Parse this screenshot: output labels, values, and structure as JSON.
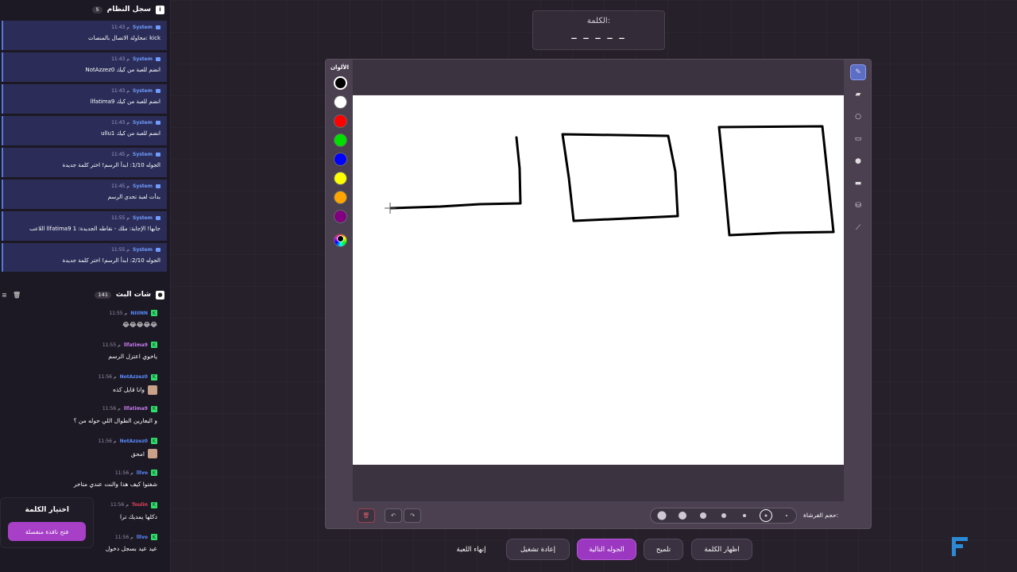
{
  "system_log": {
    "title": "سجل النظام",
    "count": "5",
    "items": [
      {
        "name": "System",
        "time": "11:43 م",
        "message": "محاولة الاتصال بالمنصات: kick"
      },
      {
        "name": "System",
        "time": "11:43 م",
        "message": "NotAzzez0 انضم للعبة من كيك"
      },
      {
        "name": "System",
        "time": "11:43 م",
        "message": "llfatima9 انضم للعبة من كيك"
      },
      {
        "name": "System",
        "time": "11:43 م",
        "message": "ullu1 انضم للعبة من كيك"
      },
      {
        "name": "System",
        "time": "11:45 م",
        "message": "الجوله 1/10: ابدأ الرسم! اختر كلمة جديدة"
      },
      {
        "name": "System",
        "time": "11:45 م",
        "message": "بدأت لعبة تحدي الرسم"
      },
      {
        "name": "System",
        "time": "11:55 م",
        "message": "اللاعب llfatima9 جابها! الإجابة: ملك - نقاطه الجديدة: 1"
      },
      {
        "name": "System",
        "time": "11:55 م",
        "message": "الجوله 2/10: ابدأ الرسم! اختر كلمة جديدة"
      }
    ]
  },
  "chat": {
    "title": "شات البث",
    "count": "141",
    "messages": [
      {
        "name": "NIIINN",
        "name_color": "#5a8cff",
        "time": "11:55 م",
        "message": "😂😂😂😂😂"
      },
      {
        "name": "llfatima9",
        "name_color": "#c87cf0",
        "time": "11:55 م",
        "message": "ياخوي اعتزل الرسم"
      },
      {
        "name": "NotAzzez0",
        "name_color": "#5a8cff",
        "time": "11:56 م",
        "message": "وانا قايل كذه"
      },
      {
        "name": "llfatima9",
        "name_color": "#c87cf0",
        "time": "11:56 م",
        "message": "و البعارين الطوال اللي حوله من ؟"
      },
      {
        "name": "NotAzzez0",
        "name_color": "#5a8cff",
        "time": "11:56 م",
        "message": "امحق"
      },
      {
        "name": "lllvo",
        "name_color": "#5a8cff",
        "time": "11:56 م",
        "message": "شفتوا كيف هذا والنت عندي متاخر"
      },
      {
        "name": "Toulin",
        "name_color": "#e0405a",
        "time": "11:56 م",
        "message": "دكلها يمديك ترا"
      },
      {
        "name": "lllvo",
        "name_color": "#5a8cff",
        "time": "11:56 م",
        "message": "عيد عيد بسجل دخول"
      }
    ]
  },
  "word_picker": {
    "title": "اختيار الكلمة",
    "button": "فتح نافذة منفصلة"
  },
  "word": {
    "label": "الكلمة:",
    "hidden": "_ _ _ _ _"
  },
  "palette": {
    "label": "الألوان",
    "colors": [
      "#000000",
      "#ffffff",
      "#ff0000",
      "#00e000",
      "#0000ff",
      "#ffff00",
      "#ffa500",
      "#800080"
    ]
  },
  "tools": [
    "pen-icon",
    "eraser-icon",
    "circle-icon",
    "rectangle-icon",
    "filled-circle-icon",
    "filled-rectangle-icon",
    "fill-bucket-icon",
    "line-icon"
  ],
  "brush": {
    "label": "حجم الفرشاة:"
  },
  "bottom_buttons": {
    "reveal": "اظهار الكلمة",
    "hint": "تلميح",
    "next_round": "الجوله التالية",
    "restart": "إعادة تشغيل",
    "end_game": "إنهاء اللعبة"
  }
}
